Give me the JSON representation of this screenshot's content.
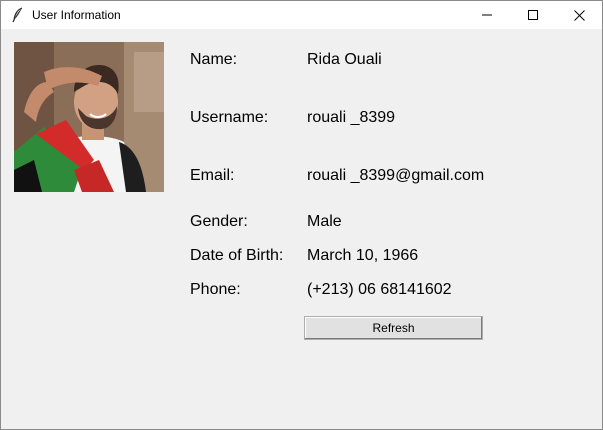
{
  "window": {
    "title": "User Information"
  },
  "profile": {
    "fields": [
      {
        "label": "Name:",
        "value": "Rida Ouali"
      },
      {
        "label": "Username:",
        "value": "rouali _8399"
      },
      {
        "label": "Email:",
        "value": "rouali _8399@gmail.com"
      },
      {
        "label": "Gender:",
        "value": "Male"
      },
      {
        "label": "Date of Birth:",
        "value": "March 10, 1966"
      },
      {
        "label": "Phone:",
        "value": "(+213) 06 68141602"
      }
    ],
    "refresh_label": "Refresh"
  },
  "icons": {
    "app": "feather-icon",
    "minimize": "minimize-icon",
    "maximize": "maximize-icon",
    "close": "close-icon"
  },
  "colors": {
    "background": "#f0f0f0",
    "titlebar": "#ffffff",
    "button": "#e1e1e1"
  }
}
